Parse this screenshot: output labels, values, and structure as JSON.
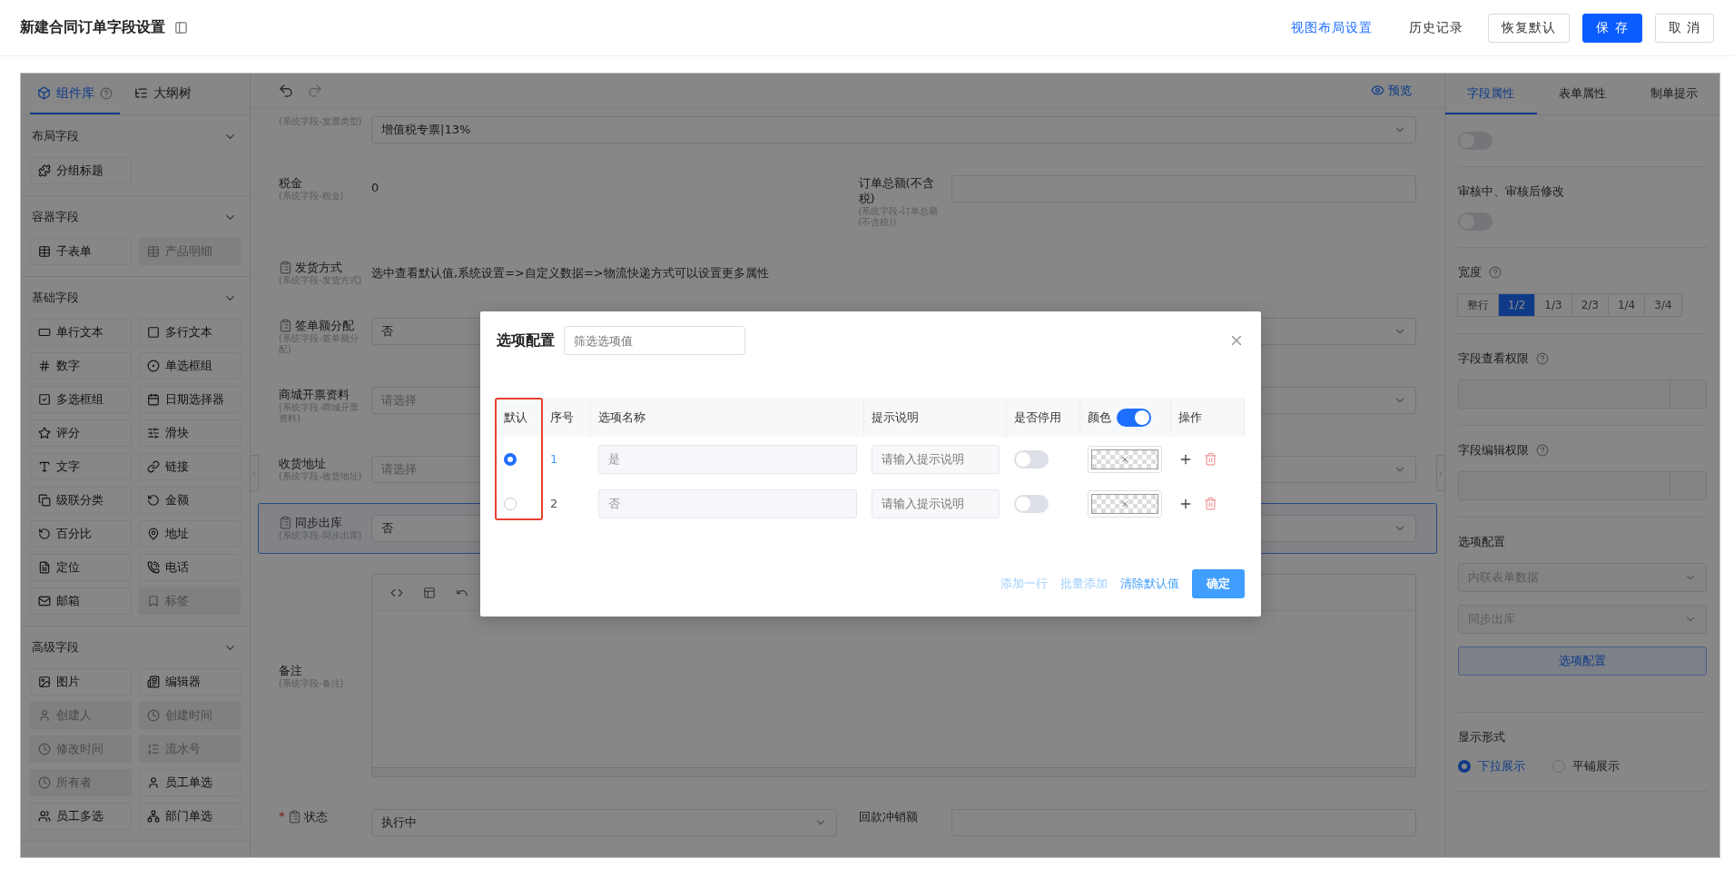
{
  "header": {
    "title": "新建合同订单字段设置",
    "actions": [
      {
        "label": "视图布局设置",
        "kind": "link"
      },
      {
        "label": "历史记录",
        "kind": "text"
      },
      {
        "label": "恢复默认",
        "kind": "default"
      },
      {
        "label": "保 存",
        "kind": "primary"
      },
      {
        "label": "取 消",
        "kind": "default"
      }
    ]
  },
  "left_panel": {
    "tabs": [
      {
        "label": "组件库",
        "selected": true,
        "help": true
      },
      {
        "label": "大纲树",
        "selected": false,
        "help": false
      }
    ],
    "sections": [
      {
        "title": "布局字段",
        "items": [
          {
            "label": "分组标题",
            "disabled": false
          }
        ]
      },
      {
        "title": "容器字段",
        "items": [
          {
            "label": "子表单",
            "disabled": false
          },
          {
            "label": "产品明细",
            "disabled": true
          }
        ]
      },
      {
        "title": "基础字段",
        "items": [
          {
            "label": "单行文本",
            "disabled": false
          },
          {
            "label": "多行文本",
            "disabled": false
          },
          {
            "label": "数字",
            "disabled": false
          },
          {
            "label": "单选框组",
            "disabled": false
          },
          {
            "label": "多选框组",
            "disabled": false
          },
          {
            "label": "日期选择器",
            "disabled": false
          },
          {
            "label": "评分",
            "disabled": false
          },
          {
            "label": "滑块",
            "disabled": false
          },
          {
            "label": "文字",
            "disabled": false
          },
          {
            "label": "链接",
            "disabled": false
          },
          {
            "label": "级联分类",
            "disabled": false
          },
          {
            "label": "金额",
            "disabled": false
          },
          {
            "label": "百分比",
            "disabled": false
          },
          {
            "label": "地址",
            "disabled": false
          },
          {
            "label": "定位",
            "disabled": false
          },
          {
            "label": "电话",
            "disabled": false
          },
          {
            "label": "邮箱",
            "disabled": false
          },
          {
            "label": "标签",
            "disabled": true
          }
        ]
      },
      {
        "title": "高级字段",
        "items": [
          {
            "label": "图片",
            "disabled": false
          },
          {
            "label": "编辑器",
            "disabled": false
          },
          {
            "label": "创建人",
            "disabled": true
          },
          {
            "label": "创建时间",
            "disabled": true
          },
          {
            "label": "修改时间",
            "disabled": true
          },
          {
            "label": "流水号",
            "disabled": true
          },
          {
            "label": "所有者",
            "disabled": true
          },
          {
            "label": "员工单选",
            "disabled": false
          },
          {
            "label": "员工多选",
            "disabled": false
          },
          {
            "label": "部门单选",
            "disabled": false
          }
        ]
      }
    ]
  },
  "canvas": {
    "preview": "预览",
    "rows": [
      {
        "selected": false,
        "fields": [
          {
            "kind": "select",
            "sublabel": "(系统字段-发票类型)",
            "value": "增值税专票|13%",
            "doc_icon": false
          }
        ]
      },
      {
        "selected": false,
        "fields": [
          {
            "kind": "static",
            "label": "税金",
            "sublabel": "(系统字段-税金)",
            "value": "0",
            "doc_icon": false
          },
          {
            "kind": "input",
            "label": "订单总额(不含税)",
            "sublabel": "(系统字段-订单总额(不含税))",
            "doc_icon": false
          }
        ]
      },
      {
        "selected": false,
        "fields": [
          {
            "kind": "static",
            "label": "发货方式",
            "sublabel": "(系统字段-发货方式)",
            "value": "选中查看默认值,系统设置=>自定义数据=>物流快递方式可以设置更多属性",
            "doc_icon": true
          }
        ]
      },
      {
        "selected": false,
        "fields": [
          {
            "kind": "select",
            "label": "签单额分配",
            "sublabel": "(系统字段-签单额分配)",
            "value": "否",
            "doc_icon": true
          }
        ]
      },
      {
        "selected": false,
        "fields": [
          {
            "kind": "select",
            "label": "商城开票资料",
            "sublabel": "(系统字段-商城开票资料)",
            "placeholder": "请选择",
            "doc_icon": false
          }
        ]
      },
      {
        "selected": false,
        "fields": [
          {
            "kind": "select",
            "label": "收货地址",
            "sublabel": "(系统字段-收货地址)",
            "placeholder": "请选择",
            "doc_icon": false
          }
        ]
      },
      {
        "selected": true,
        "fields": [
          {
            "kind": "select",
            "label": "同步出库",
            "sublabel": "(系统字段-同步出库)",
            "value": "否",
            "doc_icon": true
          }
        ]
      },
      {
        "selected": false,
        "fields": [
          {
            "kind": "editor",
            "label": "备注",
            "sublabel": "(系统字段-备注)",
            "doc_icon": false
          }
        ]
      },
      {
        "selected": false,
        "fields": [
          {
            "kind": "select",
            "label": "状态",
            "value": "执行中",
            "doc_icon": true,
            "required_mark": "*"
          },
          {
            "kind": "input",
            "label": "回款冲销额",
            "doc_icon": false
          }
        ]
      }
    ]
  },
  "right_panel": {
    "tabs": [
      {
        "label": "字段属性",
        "selected": true
      },
      {
        "label": "表单属性",
        "selected": false
      },
      {
        "label": "制单提示",
        "selected": false
      }
    ],
    "sections": [
      {
        "kind": "switch",
        "on": false
      },
      {
        "kind": "switch",
        "label": "审核中、审核后修改",
        "on": false
      },
      {
        "kind": "segments",
        "label": "宽度",
        "help": true,
        "options": [
          {
            "label": "整行",
            "selected": false
          },
          {
            "label": "1/2",
            "selected": true
          },
          {
            "label": "1/3",
            "selected": false
          },
          {
            "label": "2/3",
            "selected": false
          },
          {
            "label": "1/4",
            "selected": false
          },
          {
            "label": "3/4",
            "selected": false
          }
        ]
      },
      {
        "kind": "permission",
        "label": "字段查看权限",
        "help": true
      },
      {
        "kind": "permission",
        "label": "字段编辑权限",
        "help": true
      },
      {
        "kind": "options",
        "label": "选项配置",
        "selects": [
          "内联表单数据",
          "同步出库"
        ],
        "button": "选项配置"
      },
      {
        "kind": "radios",
        "label": "显示形式",
        "options": [
          {
            "label": "下拉展示",
            "selected": true
          },
          {
            "label": "平铺展示",
            "selected": false
          }
        ]
      }
    ]
  },
  "dialog": {
    "title": "选项配置",
    "filter_placeholder": "筛选选项值",
    "columns": [
      {
        "label": "默认",
        "highlighted": true
      },
      {
        "label": "序号",
        "highlighted": false
      },
      {
        "label": "选项名称",
        "highlighted": false
      },
      {
        "label": "提示说明",
        "highlighted": false
      },
      {
        "label": "是否停用",
        "highlighted": false
      },
      {
        "label": "颜色",
        "highlighted": false
      },
      {
        "label": "操作",
        "highlighted": false
      }
    ],
    "color_enabled": true,
    "rows": [
      {
        "selected": true,
        "index": "1",
        "name": "是",
        "hint_placeholder": "请输入提示说明",
        "disabled": false
      },
      {
        "selected": false,
        "index": "2",
        "name": "否",
        "hint_placeholder": "请输入提示说明",
        "disabled": false
      }
    ],
    "actions": [
      {
        "label": "添加一行",
        "disabled": true
      },
      {
        "label": "批量添加",
        "disabled": true
      },
      {
        "label": "清除默认值",
        "disabled": false
      }
    ],
    "confirm": "确定"
  }
}
